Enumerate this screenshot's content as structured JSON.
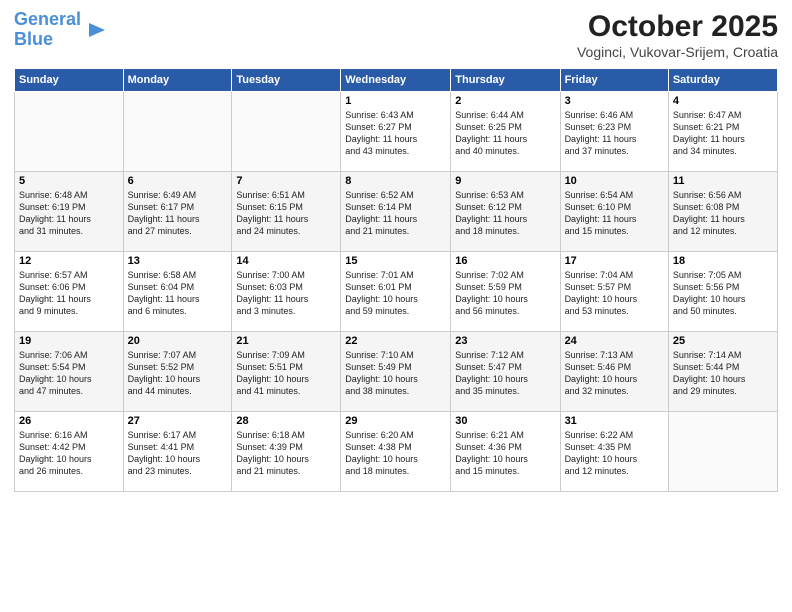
{
  "header": {
    "logo_line1": "General",
    "logo_line2": "Blue",
    "month": "October 2025",
    "location": "Voginci, Vukovar-Srijem, Croatia"
  },
  "weekdays": [
    "Sunday",
    "Monday",
    "Tuesday",
    "Wednesday",
    "Thursday",
    "Friday",
    "Saturday"
  ],
  "weeks": [
    [
      {
        "day": "",
        "info": ""
      },
      {
        "day": "",
        "info": ""
      },
      {
        "day": "",
        "info": ""
      },
      {
        "day": "1",
        "info": "Sunrise: 6:43 AM\nSunset: 6:27 PM\nDaylight: 11 hours\nand 43 minutes."
      },
      {
        "day": "2",
        "info": "Sunrise: 6:44 AM\nSunset: 6:25 PM\nDaylight: 11 hours\nand 40 minutes."
      },
      {
        "day": "3",
        "info": "Sunrise: 6:46 AM\nSunset: 6:23 PM\nDaylight: 11 hours\nand 37 minutes."
      },
      {
        "day": "4",
        "info": "Sunrise: 6:47 AM\nSunset: 6:21 PM\nDaylight: 11 hours\nand 34 minutes."
      }
    ],
    [
      {
        "day": "5",
        "info": "Sunrise: 6:48 AM\nSunset: 6:19 PM\nDaylight: 11 hours\nand 31 minutes."
      },
      {
        "day": "6",
        "info": "Sunrise: 6:49 AM\nSunset: 6:17 PM\nDaylight: 11 hours\nand 27 minutes."
      },
      {
        "day": "7",
        "info": "Sunrise: 6:51 AM\nSunset: 6:15 PM\nDaylight: 11 hours\nand 24 minutes."
      },
      {
        "day": "8",
        "info": "Sunrise: 6:52 AM\nSunset: 6:14 PM\nDaylight: 11 hours\nand 21 minutes."
      },
      {
        "day": "9",
        "info": "Sunrise: 6:53 AM\nSunset: 6:12 PM\nDaylight: 11 hours\nand 18 minutes."
      },
      {
        "day": "10",
        "info": "Sunrise: 6:54 AM\nSunset: 6:10 PM\nDaylight: 11 hours\nand 15 minutes."
      },
      {
        "day": "11",
        "info": "Sunrise: 6:56 AM\nSunset: 6:08 PM\nDaylight: 11 hours\nand 12 minutes."
      }
    ],
    [
      {
        "day": "12",
        "info": "Sunrise: 6:57 AM\nSunset: 6:06 PM\nDaylight: 11 hours\nand 9 minutes."
      },
      {
        "day": "13",
        "info": "Sunrise: 6:58 AM\nSunset: 6:04 PM\nDaylight: 11 hours\nand 6 minutes."
      },
      {
        "day": "14",
        "info": "Sunrise: 7:00 AM\nSunset: 6:03 PM\nDaylight: 11 hours\nand 3 minutes."
      },
      {
        "day": "15",
        "info": "Sunrise: 7:01 AM\nSunset: 6:01 PM\nDaylight: 10 hours\nand 59 minutes."
      },
      {
        "day": "16",
        "info": "Sunrise: 7:02 AM\nSunset: 5:59 PM\nDaylight: 10 hours\nand 56 minutes."
      },
      {
        "day": "17",
        "info": "Sunrise: 7:04 AM\nSunset: 5:57 PM\nDaylight: 10 hours\nand 53 minutes."
      },
      {
        "day": "18",
        "info": "Sunrise: 7:05 AM\nSunset: 5:56 PM\nDaylight: 10 hours\nand 50 minutes."
      }
    ],
    [
      {
        "day": "19",
        "info": "Sunrise: 7:06 AM\nSunset: 5:54 PM\nDaylight: 10 hours\nand 47 minutes."
      },
      {
        "day": "20",
        "info": "Sunrise: 7:07 AM\nSunset: 5:52 PM\nDaylight: 10 hours\nand 44 minutes."
      },
      {
        "day": "21",
        "info": "Sunrise: 7:09 AM\nSunset: 5:51 PM\nDaylight: 10 hours\nand 41 minutes."
      },
      {
        "day": "22",
        "info": "Sunrise: 7:10 AM\nSunset: 5:49 PM\nDaylight: 10 hours\nand 38 minutes."
      },
      {
        "day": "23",
        "info": "Sunrise: 7:12 AM\nSunset: 5:47 PM\nDaylight: 10 hours\nand 35 minutes."
      },
      {
        "day": "24",
        "info": "Sunrise: 7:13 AM\nSunset: 5:46 PM\nDaylight: 10 hours\nand 32 minutes."
      },
      {
        "day": "25",
        "info": "Sunrise: 7:14 AM\nSunset: 5:44 PM\nDaylight: 10 hours\nand 29 minutes."
      }
    ],
    [
      {
        "day": "26",
        "info": "Sunrise: 6:16 AM\nSunset: 4:42 PM\nDaylight: 10 hours\nand 26 minutes."
      },
      {
        "day": "27",
        "info": "Sunrise: 6:17 AM\nSunset: 4:41 PM\nDaylight: 10 hours\nand 23 minutes."
      },
      {
        "day": "28",
        "info": "Sunrise: 6:18 AM\nSunset: 4:39 PM\nDaylight: 10 hours\nand 21 minutes."
      },
      {
        "day": "29",
        "info": "Sunrise: 6:20 AM\nSunset: 4:38 PM\nDaylight: 10 hours\nand 18 minutes."
      },
      {
        "day": "30",
        "info": "Sunrise: 6:21 AM\nSunset: 4:36 PM\nDaylight: 10 hours\nand 15 minutes."
      },
      {
        "day": "31",
        "info": "Sunrise: 6:22 AM\nSunset: 4:35 PM\nDaylight: 10 hours\nand 12 minutes."
      },
      {
        "day": "",
        "info": ""
      }
    ]
  ]
}
